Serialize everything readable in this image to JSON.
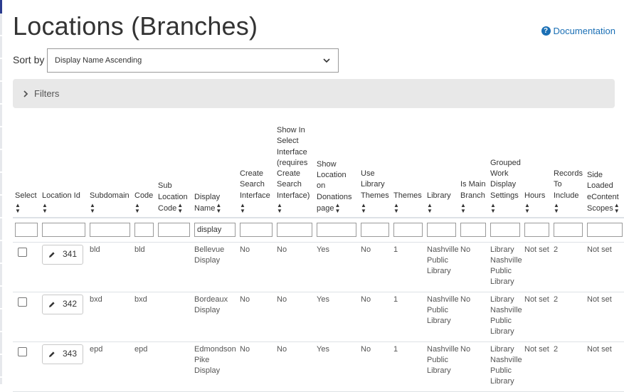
{
  "page": {
    "title": "Locations (Branches)",
    "documentation_link": "Documentation",
    "sort_label": "Sort by",
    "sort_value": "Display Name Ascending",
    "filters_label": "Filters"
  },
  "table": {
    "columns": [
      {
        "key": "select",
        "label": "Select"
      },
      {
        "key": "location_id",
        "label": "Location Id"
      },
      {
        "key": "subdomain",
        "label": "Subdomain"
      },
      {
        "key": "code",
        "label": "Code"
      },
      {
        "key": "sub_location_code",
        "label": "Sub Location Code"
      },
      {
        "key": "display_name",
        "label": "Display Name"
      },
      {
        "key": "create_search_interface",
        "label": "Create Search Interface"
      },
      {
        "key": "show_in_select_interface",
        "label": "Show In Select Interface (requires Create Search Interface)"
      },
      {
        "key": "show_on_donations",
        "label": "Show Location on Donations page"
      },
      {
        "key": "use_library_themes",
        "label": "Use Library Themes"
      },
      {
        "key": "themes",
        "label": "Themes"
      },
      {
        "key": "library",
        "label": "Library"
      },
      {
        "key": "is_main_branch",
        "label": "Is Main Branch"
      },
      {
        "key": "grouped_work_display",
        "label": "Grouped Work Display Settings"
      },
      {
        "key": "hours",
        "label": "Hours"
      },
      {
        "key": "records_to_include",
        "label": "Records To Include"
      },
      {
        "key": "side_loaded_scopes",
        "label": "Side Loaded eContent Scopes"
      }
    ],
    "filters": {
      "display_name": "display"
    },
    "rows": [
      {
        "location_id": "341",
        "subdomain": "bld",
        "code": "bld",
        "sub_location_code": "",
        "display_name": "Bellevue Display",
        "create_search_interface": "No",
        "show_in_select_interface": "No",
        "show_on_donations": "Yes",
        "use_library_themes": "No",
        "themes": "1",
        "library": "Nashville Public Library",
        "is_main_branch": "No",
        "grouped_work_display": "Library Nashville Public Library",
        "hours": "Not set",
        "records_to_include": "2",
        "side_loaded_scopes": "Not set"
      },
      {
        "location_id": "342",
        "subdomain": "bxd",
        "code": "bxd",
        "sub_location_code": "",
        "display_name": "Bordeaux Display",
        "create_search_interface": "No",
        "show_in_select_interface": "No",
        "show_on_donations": "Yes",
        "use_library_themes": "No",
        "themes": "1",
        "library": "Nashville Public Library",
        "is_main_branch": "No",
        "grouped_work_display": "Library Nashville Public Library",
        "hours": "Not set",
        "records_to_include": "2",
        "side_loaded_scopes": "Not set"
      },
      {
        "location_id": "343",
        "subdomain": "epd",
        "code": "epd",
        "sub_location_code": "",
        "display_name": "Edmondson Pike Display",
        "create_search_interface": "No",
        "show_in_select_interface": "No",
        "show_on_donations": "Yes",
        "use_library_themes": "No",
        "themes": "1",
        "library": "Nashville Public Library",
        "is_main_branch": "No",
        "grouped_work_display": "Library Nashville Public Library",
        "hours": "Not set",
        "records_to_include": "2",
        "side_loaded_scopes": "Not set"
      }
    ]
  },
  "icons": {
    "documentation": "question-circle-icon",
    "sort_dropdown": "chevron-down-icon",
    "filters_toggle": "chevron-right-icon",
    "column_sort": "sort-arrows-icon",
    "edit": "pencil-icon"
  },
  "colors": {
    "link": "#1a6fb5",
    "filters_bg": "#e8e8e8",
    "left_accent": "#2b3c8f"
  }
}
